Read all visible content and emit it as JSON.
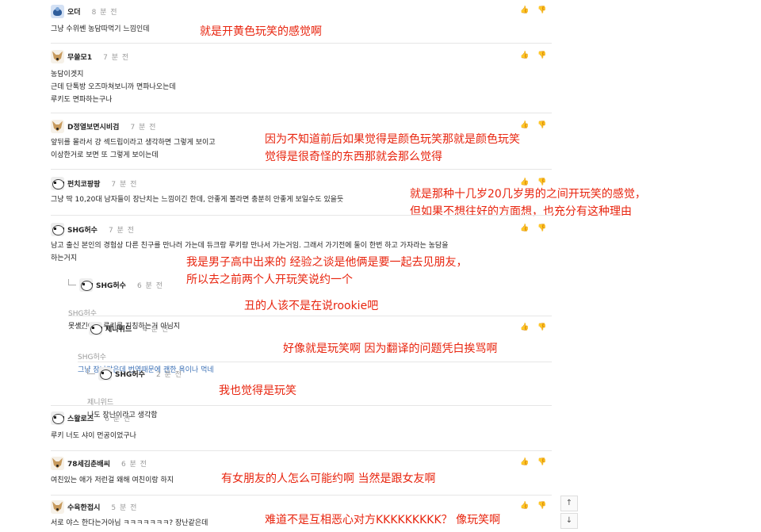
{
  "comments": [
    {
      "name": "오더",
      "time": "8 분 전",
      "text": "그냥 수위쎈 농담따먹기 느낌인데",
      "annotation": "就是开黄色玩笑的感觉啊"
    },
    {
      "name": "무쓸모1",
      "time": "7 분 전",
      "text": "농담이겟지\n근데 단톡방 오즈마쳐보니까 면파나오는데\n루키도 면파하는구나",
      "annotation": ""
    },
    {
      "name": "D정열보면시비검",
      "time": "7 분 전",
      "text": "앞뒤를 몰라서 걍 섹드립이라고 생각하면 그렇게 보이고\n이상한거로 보면 또 그렇게 보이는데",
      "annotation": "因为不知道前后如果觉得是颜色玩笑那就是颜色玩笑\n觉得是很奇怪的东西那就会那么觉得"
    },
    {
      "name": "펀치코팡팡",
      "time": "7 분 전",
      "text": "그냥 딱 10,20대 남자들이 장난치는 느낌이긴 한데, 안좋게 볼라면 충분히 안좋게 보일수도 있을듯",
      "annotation": "就是那种十几岁20几岁男的之间开玩笑的感觉，\n但如果不想往好的方面想，也充分有这种理由"
    },
    {
      "name": "SHG허수",
      "time": "7 분 전",
      "text": "남고 출신 본인의 경험상 다른 친구를 만나러 가는데 듀크랑 루키랑 만나서 가는거임. 그래서 가기전에 둘이 한번 하고 가자라는 농담을\n하는거지",
      "annotation": "我是男子高中出来的 经验之谈是他俩是要一起去见朋友，\n所以去之前两个人开玩笑说约一个"
    },
    {
      "name": "스왈로즈",
      "time": "6 분 전",
      "text": "루키 너도 샤이 먼공이었구나",
      "annotation": ""
    },
    {
      "name": "78세김춘배씨",
      "time": "6 분 전",
      "text": "여친있는 애가 저런걸 왜해 여친이랑 하지",
      "annotation": "有女朋友的人怎么可能约啊 当然是跟女友啊"
    },
    {
      "name": "수육한접시",
      "time": "5 분 전",
      "text": "서로 야스 한다는거아님 ㅋㅋㅋㅋㅋㅋㅋ? 장난같은데",
      "annotation": "难道不是互相恶心对方KKKKKKKKK？ 像玩笑啊"
    }
  ],
  "replies": [
    {
      "name": "SHG허수",
      "time": "6 분 전",
      "mention": "SHG허수",
      "text": "못생긴애는 루키를 지칭하는거 아님지",
      "annotation": "丑的人该不是在说rookie吧"
    },
    {
      "name": "제니위드",
      "time": "4 분 전",
      "mention": "SHG허수",
      "text": "그냥 장난같은데 번역때문에 괜한 욕이나 먹네",
      "annotation": "好像就是玩笑啊 因为翻译的问题凭白挨骂啊"
    },
    {
      "name": "SHG허수",
      "time": "2 분 전",
      "mention": "제니위드",
      "text": "나도 장난이라고 생각함",
      "annotation": "我也觉得是玩笑"
    }
  ],
  "icons": {
    "like": "thumbs-up-icon",
    "dislike": "thumbs-down-icon",
    "scroll_up": "arrow-up-icon",
    "scroll_down": "arrow-down-icon"
  },
  "scroll": {
    "up": "↑",
    "down": "↓"
  },
  "colors": {
    "annotation": "#e8240e",
    "muted": "#999999",
    "link": "#3a6fb5"
  }
}
